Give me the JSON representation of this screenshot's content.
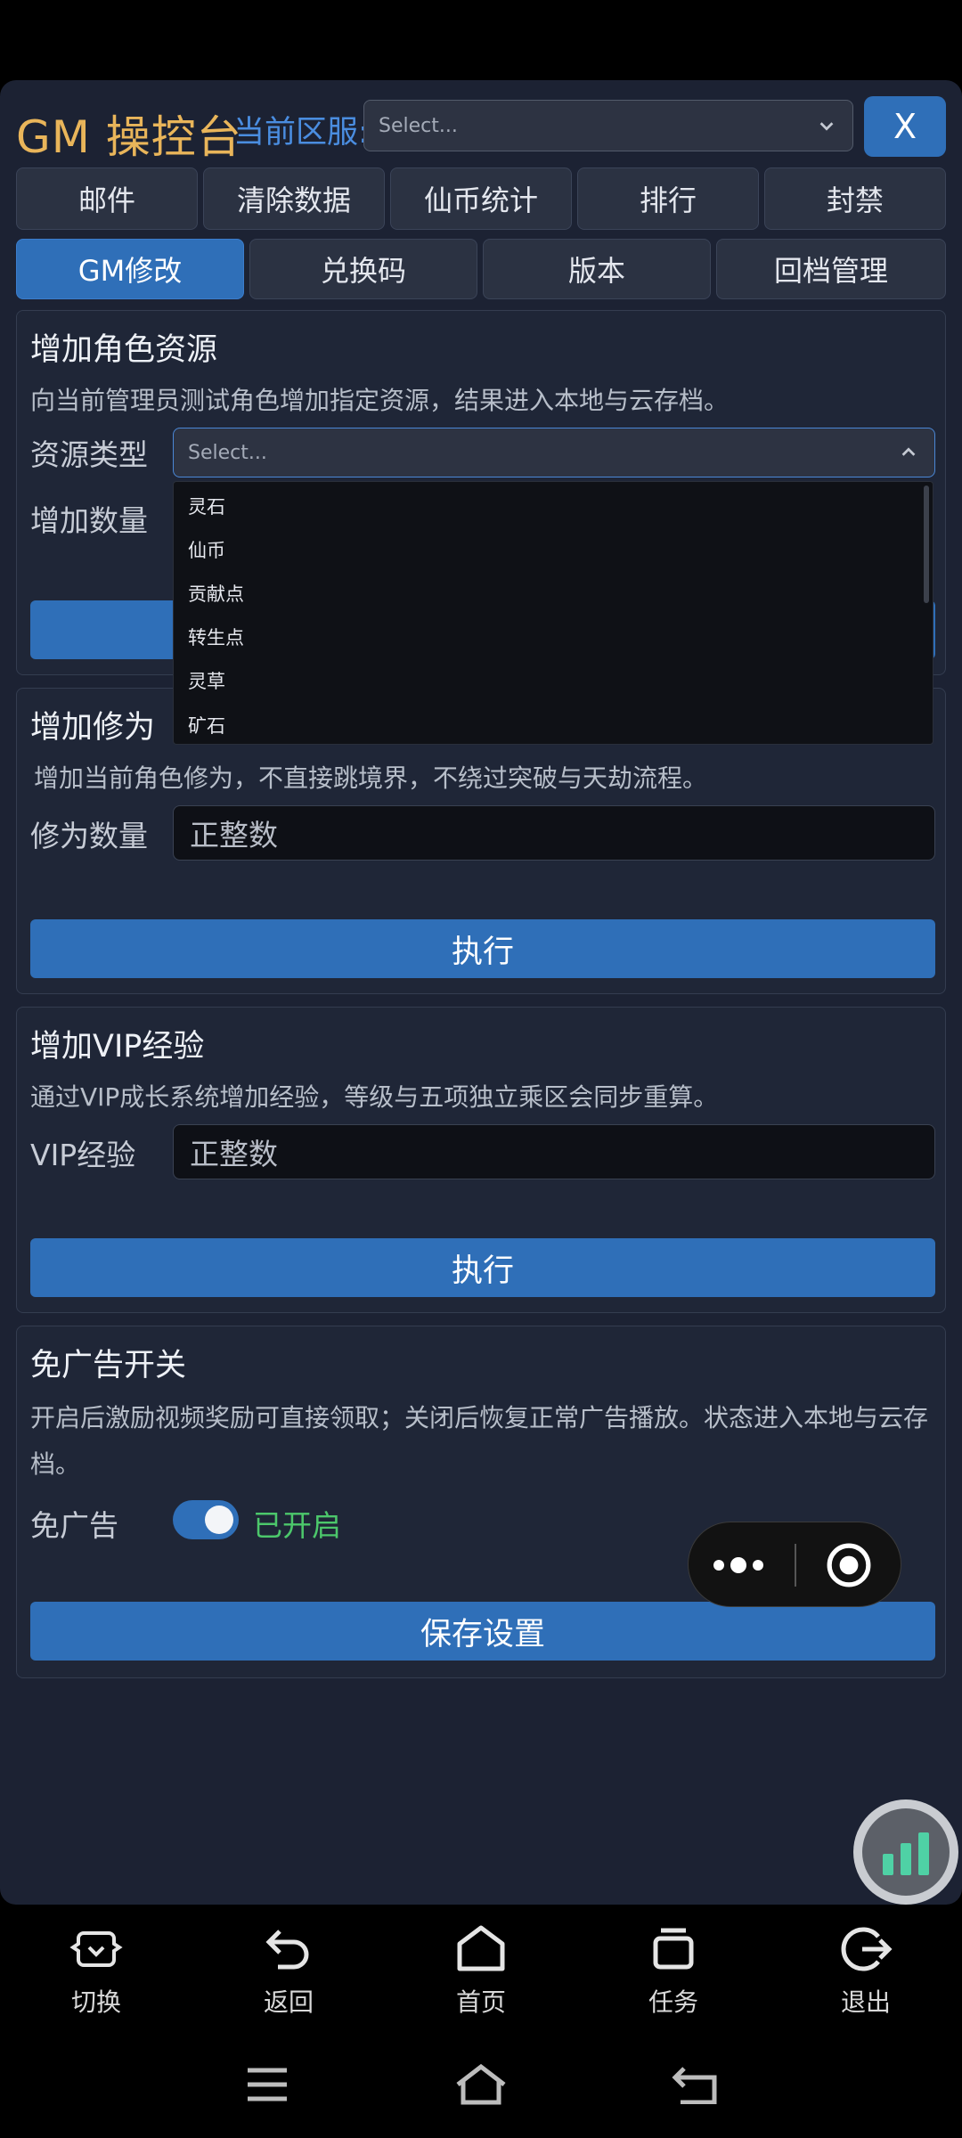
{
  "header": {
    "title": "GM 操控台",
    "region_label": "当前区服:",
    "region_select": "Select...",
    "close_label": "X"
  },
  "tabs_row1": [
    "邮件",
    "清除数据",
    "仙币统计",
    "排行",
    "封禁"
  ],
  "tabs_row2": [
    "GM修改",
    "兑换码",
    "版本",
    "回档管理"
  ],
  "active_tab": "GM修改",
  "card_resource": {
    "title": "增加角色资源",
    "desc": "向当前管理员测试角色增加指定资源，结果进入本地与云存档。",
    "type_label": "资源类型",
    "type_select": "Select...",
    "amount_label": "增加数量",
    "dropdown_options": [
      "灵石",
      "仙币",
      "贡献点",
      "转生点",
      "灵草",
      "矿石"
    ]
  },
  "card_cultivation": {
    "title": "增加修为",
    "desc": "增加当前角色修为，不直接跳境界，不绕过突破与天劫流程。",
    "amount_label": "修为数量",
    "placeholder": "正整数",
    "exec_label": "执行"
  },
  "card_vip": {
    "title": "增加VIP经验",
    "desc": "通过VIP成长系统增加经验，等级与五项独立乘区会同步重算。",
    "amount_label": "VIP经验",
    "placeholder": "正整数",
    "exec_label": "执行"
  },
  "card_noad": {
    "title": "免广告开关",
    "desc": "开启后激励视频奖励可直接领取；关闭后恢复正常广告播放。状态进入本地与云存档。",
    "toggle_label": "免广告",
    "toggle_state": "已开启",
    "toggle_on": true,
    "save_label": "保存设置"
  },
  "nav": [
    "切换",
    "返回",
    "首页",
    "任务",
    "退出"
  ],
  "colors": {
    "accent": "#2f6fb8",
    "title_gold": "#e9b55a",
    "on_green": "#4cc76b",
    "panel_bg": "#1c2233"
  }
}
